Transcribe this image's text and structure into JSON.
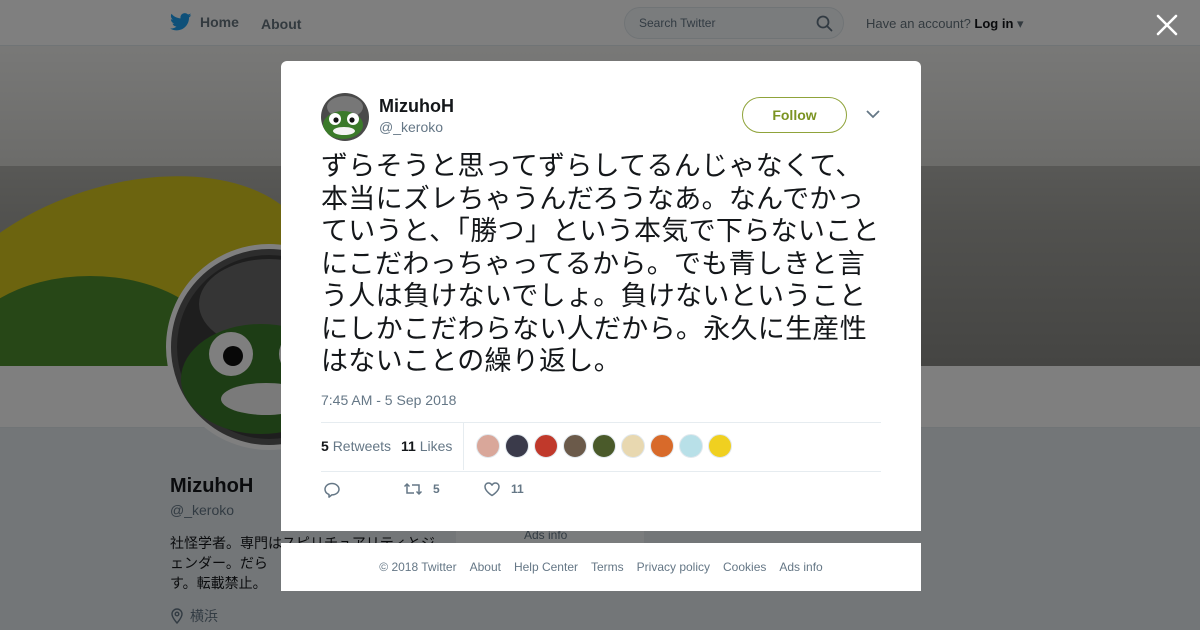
{
  "topbar": {
    "home_label": "Home",
    "about_label": "About",
    "search_placeholder": "Search Twitter",
    "have_account": "Have an account?",
    "login_label": "Log in"
  },
  "profile": {
    "name": "MizuhoH",
    "handle": "@_keroko",
    "bio": "社怪学者。専門はスピリチュアリティとジェンダー。だら\nす。転載禁止。",
    "location": "横浜",
    "ads_info": "Ads info"
  },
  "tweet": {
    "name": "MizuhoH",
    "handle": "@_keroko",
    "follow_label": "Follow",
    "text": "ずらそうと思ってずらしてるんじゃなくて、本当にズレちゃうんだろうなあ。なんでかっていうと、「勝つ」という本気で下らないことにこだわっちゃってるから。でも青しきと言う人は負けないでしょ。負けないということにしかこだわらない人だから。永久に生産性はないことの繰り返し。",
    "timestamp": "7:45 AM - 5 Sep 2018",
    "retweets_count": "5",
    "retweets_label": "Retweets",
    "likes_count": "11",
    "likes_label": "Likes",
    "action_retweet_count": "5",
    "action_like_count": "11",
    "liker_colors": [
      "#d9a79a",
      "#3a3a4a",
      "#c0392b",
      "#6b5a4a",
      "#4a5a2a",
      "#e8d8b0",
      "#d86a2a",
      "#b8e0e8",
      "#f0d020"
    ]
  },
  "footer": {
    "links": [
      "© 2018 Twitter",
      "About",
      "Help Center",
      "Terms",
      "Privacy policy",
      "Cookies",
      "Ads info"
    ]
  },
  "colors": {
    "twitter_blue": "#1da1f2",
    "follow_accent": "#7b9322"
  }
}
